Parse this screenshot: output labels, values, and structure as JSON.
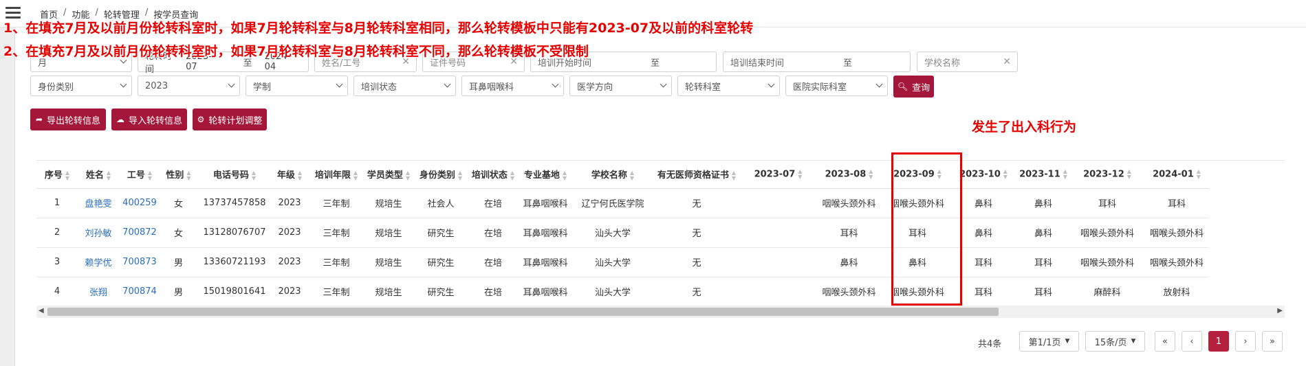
{
  "breadcrumb": [
    "首页",
    "功能",
    "轮转管理",
    "按学员查询"
  ],
  "annotations": {
    "line1": "1、在填充7月及以前月份轮转科室时，如果7月轮转科室与8月轮转科室相同，那么轮转模板中只能有2023-07及以前的科室轮转",
    "line2": "2、在填充7月及以前月份轮转科室时，如果7月轮转科室与8月轮转科室不同，那么轮转模板不受限制",
    "callout": "发生了出入科行为"
  },
  "filters": {
    "period_type": "月",
    "rotation_time_label": "轮转时间",
    "rotation_start": "2023-07",
    "rotation_to": "至",
    "rotation_end": "2024-04",
    "name_placeholder": "姓名/工号",
    "id_placeholder": "证件号码",
    "train_start_label": "培训开始时间",
    "train_start_to": "至",
    "train_end_label": "培训结束时间",
    "train_end_to": "至",
    "school_placeholder": "学校名称",
    "identity_placeholder": "身份类别",
    "grade": "2023",
    "system_placeholder": "学制",
    "status_placeholder": "培训状态",
    "base": "耳鼻咽喉科",
    "direction_placeholder": "医学方向",
    "dept_placeholder": "轮转科室",
    "hospital_dept_placeholder": "医院实际科室",
    "search_label": "查询"
  },
  "actions": {
    "export": "导出轮转信息",
    "import": "导入轮转信息",
    "adjust": "轮转计划调整"
  },
  "table": {
    "columns": [
      "序号",
      "姓名",
      "工号",
      "性别",
      "电话号码",
      "年级",
      "培训年限",
      "学员类型",
      "身份类别",
      "培训状态",
      "专业基地",
      "学校名称",
      "有无医师资格证书",
      "2023-07",
      "2023-08",
      "2023-09",
      "2023-10",
      "2023-11",
      "2023-12",
      "2024-01"
    ],
    "rows": [
      [
        "1",
        "盘艳雯",
        "400259",
        "女",
        "13737457858",
        "2023",
        "三年制",
        "规培生",
        "社会人",
        "在培",
        "耳鼻咽喉科",
        "辽宁何氏医学院",
        "无",
        "",
        "咽喉头颈外科",
        "咽喉头颈外科",
        "鼻科",
        "鼻科",
        "耳科",
        "耳科"
      ],
      [
        "2",
        "刘孙敏",
        "700872",
        "女",
        "13128076707",
        "2023",
        "三年制",
        "规培生",
        "研究生",
        "在培",
        "耳鼻咽喉科",
        "汕头大学",
        "无",
        "",
        "耳科",
        "耳科",
        "鼻科",
        "鼻科",
        "咽喉头颈外科",
        "咽喉头颈外科"
      ],
      [
        "3",
        "赖学优",
        "700873",
        "男",
        "13360721193",
        "2023",
        "三年制",
        "规培生",
        "研究生",
        "在培",
        "耳鼻咽喉科",
        "汕头大学",
        "无",
        "",
        "鼻科",
        "鼻科",
        "耳科",
        "耳科",
        "咽喉头颈外科",
        "咽喉头颈外科"
      ],
      [
        "4",
        "张翔",
        "700874",
        "男",
        "15019801641",
        "2023",
        "三年制",
        "规培生",
        "研究生",
        "在培",
        "耳鼻咽喉科",
        "汕头大学",
        "无",
        "",
        "咽喉头颈外科",
        "咽喉头颈外科",
        "耳科",
        "耳科",
        "麻醉科",
        "放射科"
      ]
    ]
  },
  "pagination": {
    "total": "共4条",
    "page_select": "第1/1页",
    "size_select": "15条/页",
    "first": "«",
    "prev": "‹",
    "current": "1",
    "next": "›",
    "last": "»"
  },
  "colors": {
    "accent": "#a5173a",
    "annotation": "#e60000",
    "link": "#2a6ebb"
  }
}
